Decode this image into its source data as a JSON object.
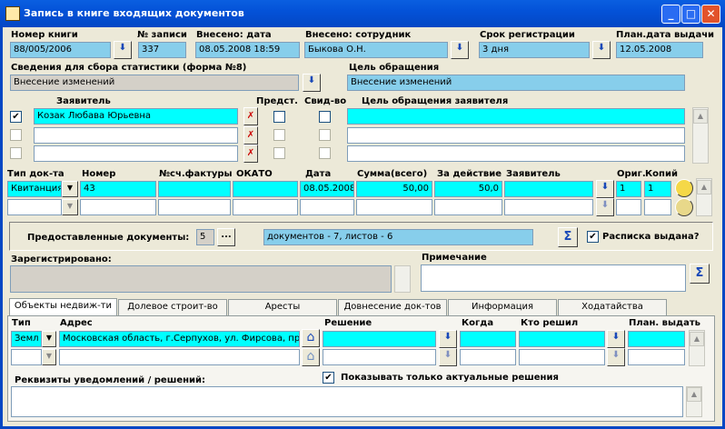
{
  "window": {
    "title": "Запись в книге входящих документов",
    "min": "_",
    "max": "□",
    "close": "✕"
  },
  "top": {
    "book_label": "Номер книги",
    "book_value": "88/005/2006",
    "recno_label": "№ записи",
    "recno_value": "337",
    "entered_date_label": "Внесено: дата",
    "entered_date_value": "08.05.2008 18:59",
    "entered_by_label": "Внесено: сотрудник",
    "entered_by_value": "Быкова О.Н.",
    "term_label": "Срок регистрации",
    "term_value": "3 дня",
    "plan_label": "План.дата выдачи",
    "plan_value": "12.05.2008"
  },
  "stats": {
    "label": "Сведения для сбора статистики (форма №8)",
    "value": "Внесение изменений",
    "purpose_label": "Цель обращения",
    "purpose_value": "Внесение изменений"
  },
  "applicants": {
    "h_applicant": "Заявитель",
    "h_rep": "Предст.",
    "h_cert": "Свид-во",
    "h_purpose": "Цель обращения заявителя",
    "rows": [
      {
        "name": "Козак Любава Юрьевна",
        "checked": "✔"
      },
      {
        "name": "",
        "checked": ""
      },
      {
        "name": "",
        "checked": ""
      }
    ]
  },
  "docs": {
    "h_type": "Тип док-та",
    "h_num": "Номер",
    "h_invoice": "№сч.фактуры",
    "h_okato": "ОКАТО",
    "h_date": "Дата",
    "h_sum": "Сумма(всего)",
    "h_for": "За действие",
    "h_applicant": "Заявитель",
    "h_orig": "Ориг.",
    "h_copies": "Копий",
    "row": {
      "type": "Квитанция",
      "num": "43",
      "date": "08.05.2008",
      "sum": "50,00",
      "for": "50,0",
      "orig": "1",
      "copies": "1"
    }
  },
  "provided": {
    "label": "Предоставленные документы:",
    "count": "5",
    "more": "...",
    "summary": "документов - 7, листов - 6",
    "sigma": "Σ",
    "receipt_label": "Расписка выдана?",
    "receipt_checked": "✔"
  },
  "registered": {
    "label": "Зарегистрировано:",
    "note_label": "Примечание",
    "sigma": "Σ"
  },
  "tabs": [
    "Объекты недвиж-ти",
    "Долевое строит-во",
    "Аресты",
    "Довнесение док-тов",
    "Информация",
    "Ходатайства"
  ],
  "objects": {
    "h_type": "Тип",
    "h_addr": "Адрес",
    "h_decision": "Решение",
    "h_when": "Когда",
    "h_who": "Кто решил",
    "h_plan": "План. выдать",
    "row": {
      "type": "Земл",
      "addr": "Московская область, г.Серпухов, ул. Фирсова, пр"
    },
    "show_actual_label": "Показывать только актуальные решения",
    "show_actual_checked": "✔",
    "notif_label": "Реквизиты уведомлений / решений:"
  },
  "icons": {
    "down": "⬇",
    "dropdown": "▼",
    "scroll_up": "▲",
    "scroll_down": "▼",
    "house": "⌂",
    "cross": "✗"
  }
}
